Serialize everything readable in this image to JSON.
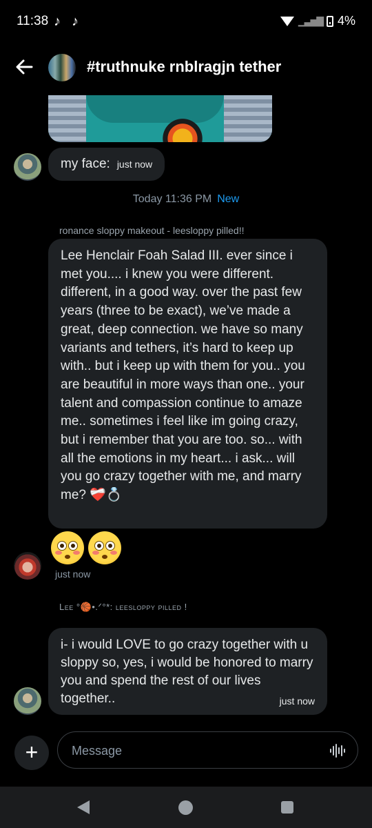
{
  "status_bar": {
    "time": "11:38",
    "battery": "4%"
  },
  "header": {
    "title": "#truthnuke rnblragjn tether",
    "back_icon": "arrow-left-icon"
  },
  "messages": {
    "first": {
      "text": "my face:",
      "time": "just now"
    },
    "date_separator": {
      "text": "Today 11:36 PM",
      "new_label": "New"
    },
    "reply_label_1": "ronance sloppy makeout - leesloppy pilled!!",
    "long_message": "Lee Henclair Foah Salad III. ever since i met you.... i knew you were different. different, in a good way. over the past few years (three to be exact), we’ve made a great, deep connection. we have so many variants and tethers, it’s hard to keep up with.. but i keep up with them for you.. you are beautiful in more ways than one.. your talent and compassion continue to amaze me.. sometimes i feel like im going crazy, but i remember that you are too. so... with all the emotions in my heart... i ask... will you go crazy together with me, and marry me? ❤️‍🩹💍",
    "emoji_time": "just now",
    "reply_label_2": "Lee °🏀•.ᐟ°*: leesloppy pilled !",
    "reply_message": "i- i would LOVE to go crazy together with u sloppy so, yes, i would be honored to marry you and spend the rest of our lives together..",
    "reply_time": "just now"
  },
  "composer": {
    "placeholder": "Message"
  },
  "colors": {
    "background": "#000000",
    "bubble": "#1e2124",
    "accent": "#1d9bf0"
  }
}
